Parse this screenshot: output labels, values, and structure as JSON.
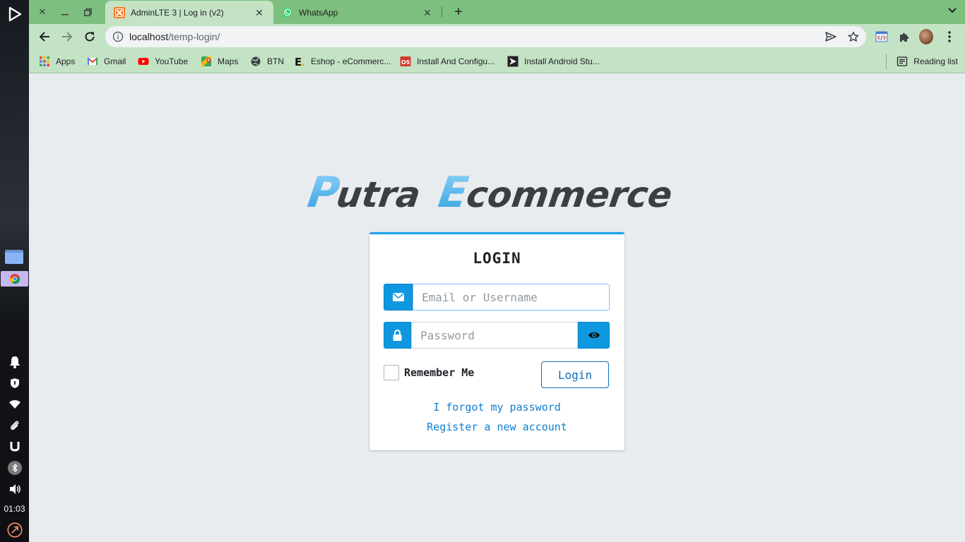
{
  "shelf": {
    "clock": "01:03"
  },
  "browser": {
    "tabs": [
      {
        "title": "AdminLTE 3 | Log in (v2)",
        "active": true
      },
      {
        "title": "WhatsApp",
        "active": false
      }
    ],
    "url_host": "localhost",
    "url_path": "/temp-login/",
    "bookmarks": [
      {
        "label": "Apps"
      },
      {
        "label": "Gmail"
      },
      {
        "label": "YouTube"
      },
      {
        "label": "Maps"
      },
      {
        "label": "BTN"
      },
      {
        "label": "Eshop - eCommerc..."
      },
      {
        "label": "Install And Configu..."
      },
      {
        "label": "Install Android Stu..."
      }
    ],
    "reading_list": "Reading list"
  },
  "page": {
    "brand": {
      "first_initial": "P",
      "first_rest": "utra",
      "second_initial": "E",
      "second_rest": "commerce"
    },
    "login": {
      "heading": "LOGIN",
      "email_placeholder": "Email or Username",
      "password_placeholder": "Password",
      "remember_label": "Remember Me",
      "login_button": "Login",
      "forgot_link": "I forgot my password",
      "register_link": "Register a new account"
    }
  },
  "colors": {
    "accent": "#0f97e0",
    "browser_frame": "#7cbf7e",
    "toolbar": "#c4e3c5",
    "page_bg": "#e9ecef"
  }
}
